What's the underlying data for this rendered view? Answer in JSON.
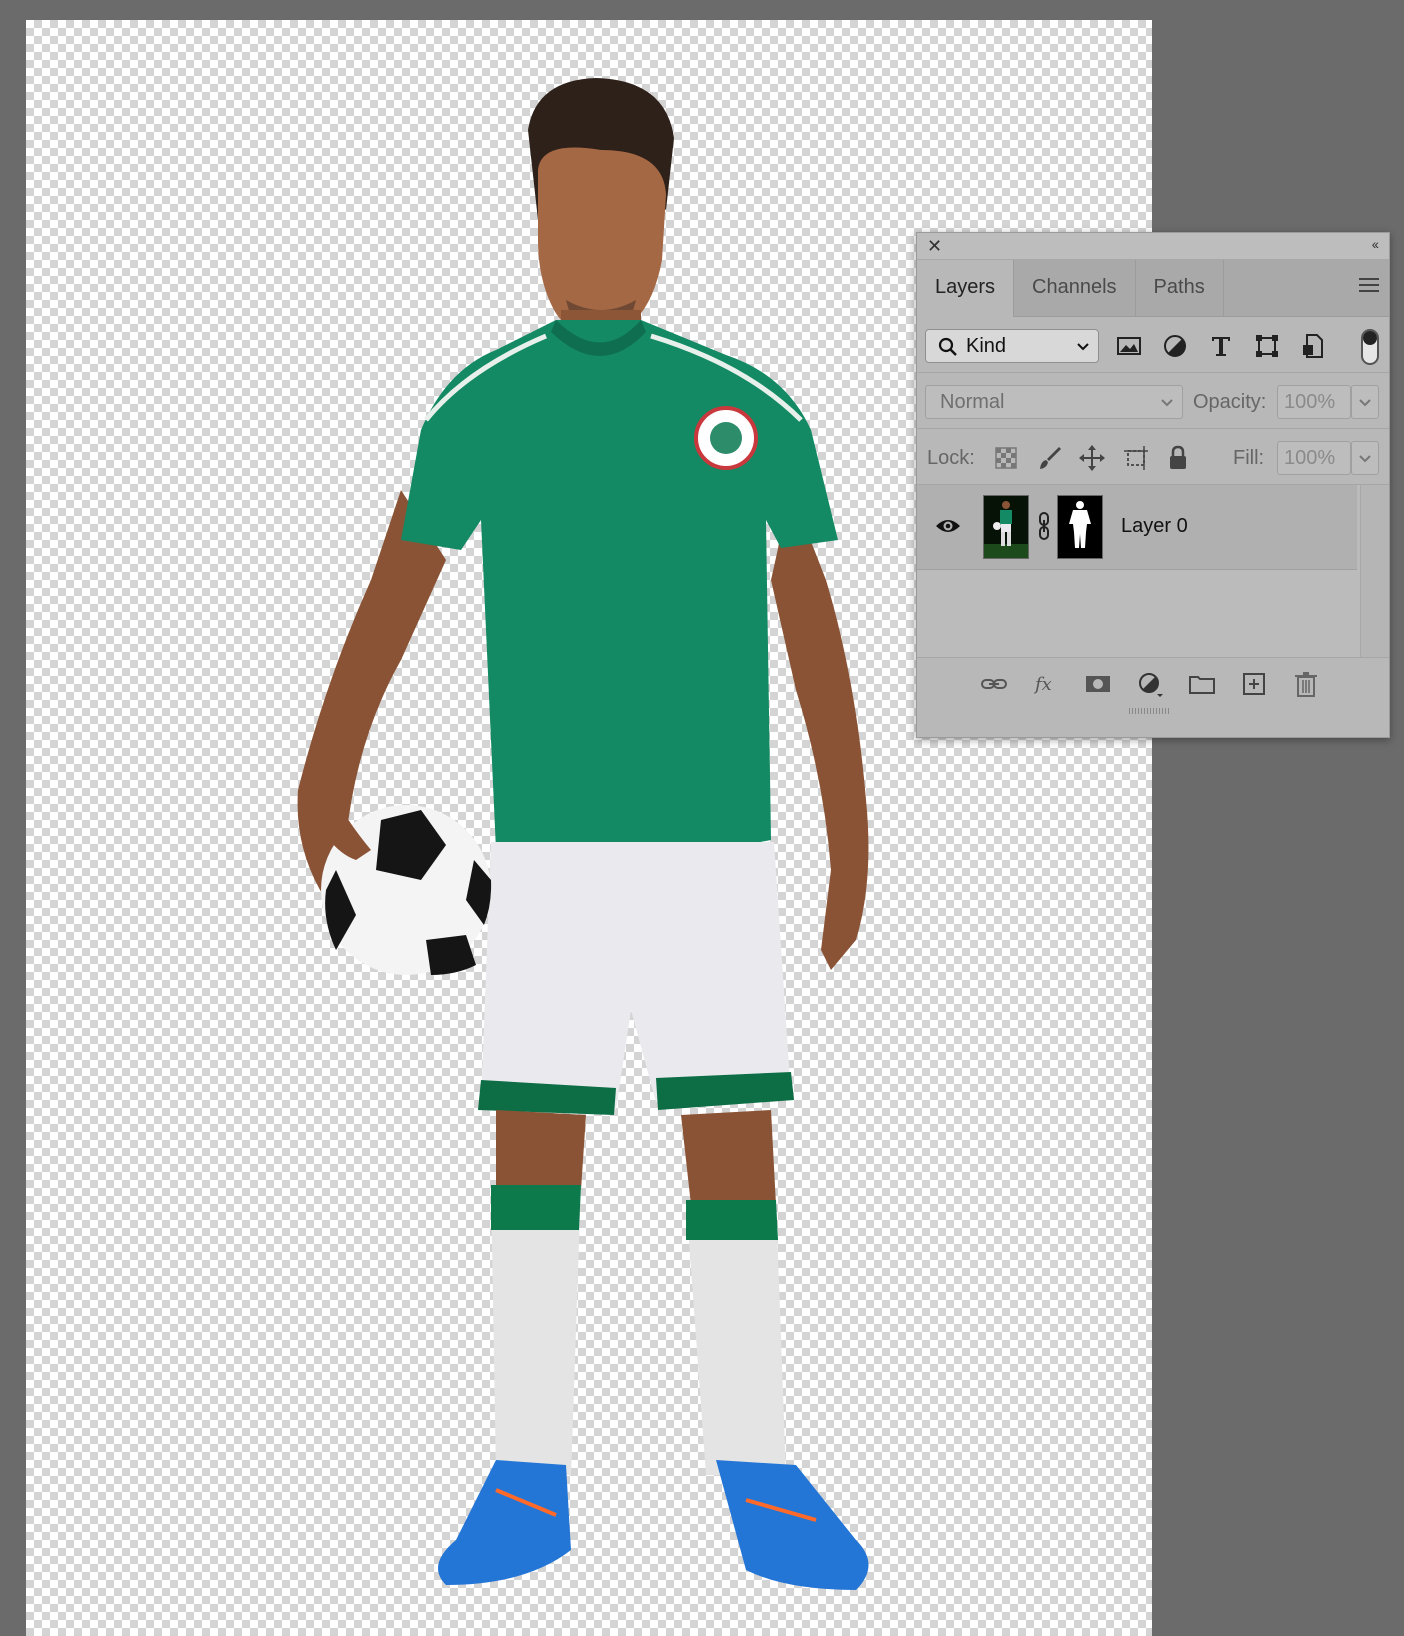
{
  "panel": {
    "tabs": [
      {
        "label": "Layers",
        "active": true
      },
      {
        "label": "Channels",
        "active": false
      },
      {
        "label": "Paths",
        "active": false
      }
    ],
    "filter": {
      "kind_label": "Kind",
      "filter_icons": [
        "image-filter-icon",
        "adjustment-filter-icon",
        "type-filter-icon",
        "shape-filter-icon",
        "smart-object-filter-icon"
      ]
    },
    "blend_mode": "Normal",
    "opacity_label": "Opacity:",
    "opacity_value": "100%",
    "lock_label": "Lock:",
    "fill_label": "Fill:",
    "fill_value": "100%",
    "layers": [
      {
        "name": "Layer 0",
        "visible": true,
        "has_mask": true
      }
    ],
    "bottom_icons": [
      "link-layers-icon",
      "fx-icon",
      "add-mask-icon",
      "new-adjustment-icon",
      "new-group-icon",
      "new-layer-icon",
      "delete-layer-icon"
    ]
  },
  "colors": {
    "panel_bg": "#b8b8b8",
    "jersey_green": "#138a63",
    "canvas_gray": "#6b6b6b"
  }
}
